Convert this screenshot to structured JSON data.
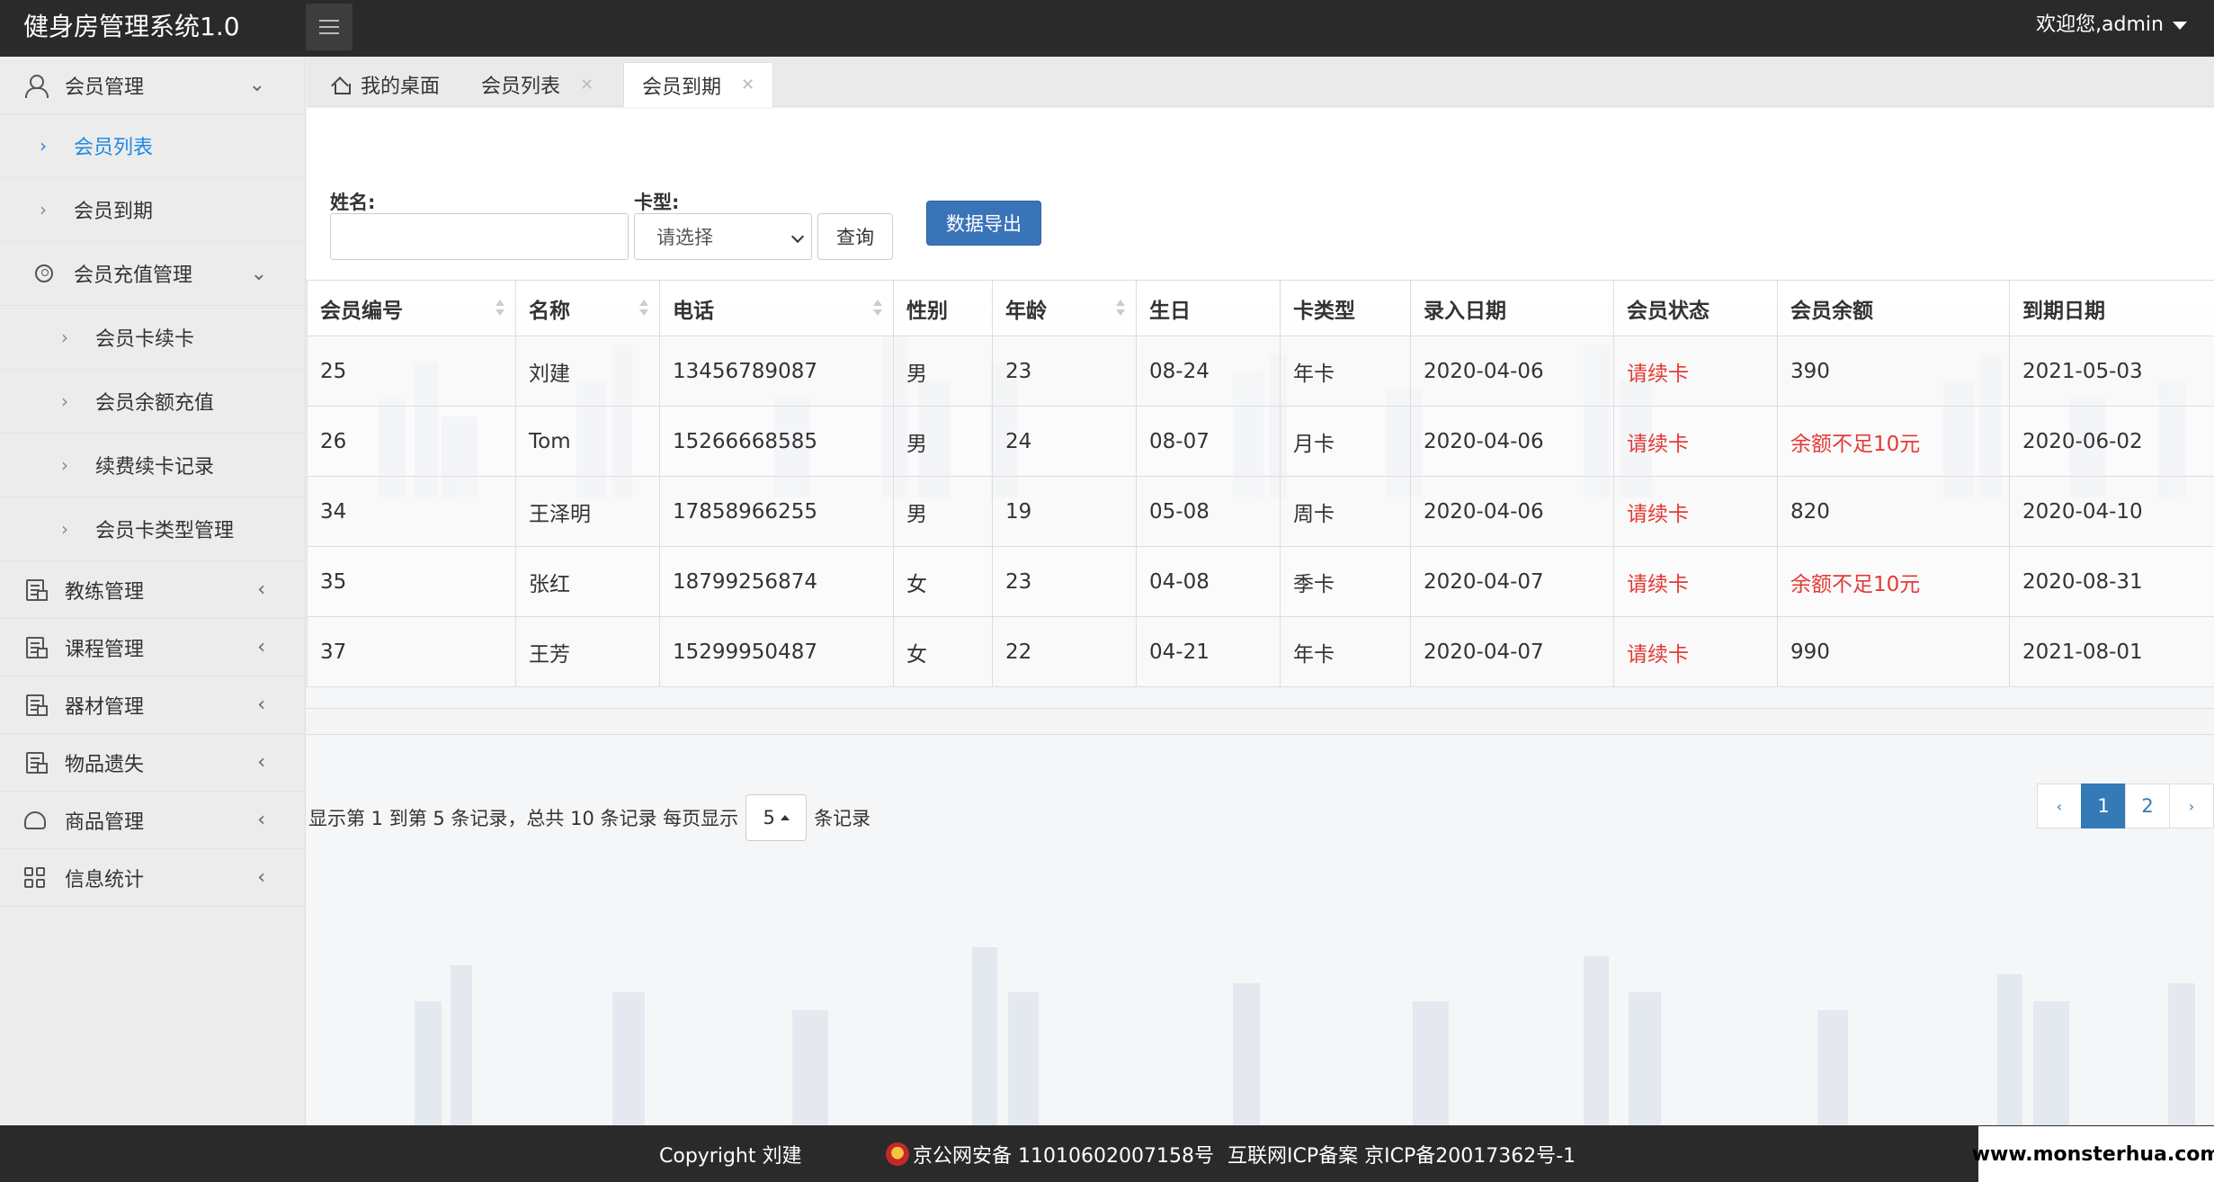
{
  "header": {
    "app_title": "健身房管理系统1.0",
    "welcome": "欢迎您,admin"
  },
  "sidebar": {
    "member_mgmt": "会员管理",
    "member_list": "会员列表",
    "member_expire": "会员到期",
    "recharge_mgmt": "会员充值管理",
    "card_renew": "会员卡续卡",
    "balance_recharge": "会员余额充值",
    "renew_records": "续费续卡记录",
    "card_type_mgmt": "会员卡类型管理",
    "coach_mgmt": "教练管理",
    "course_mgmt": "课程管理",
    "equipment_mgmt": "器材管理",
    "lost_items": "物品遗失",
    "goods_mgmt": "商品管理",
    "stats": "信息统计"
  },
  "tabs": {
    "home": "我的桌面",
    "member_list": "会员列表",
    "member_expire": "会员到期",
    "close": "✕"
  },
  "filter": {
    "name_label": "姓名:",
    "name_value": "",
    "card_label": "卡型:",
    "card_selected": "请选择",
    "query": "查询",
    "export": "数据导出"
  },
  "table": {
    "headers": [
      "会员编号",
      "名称",
      "电话",
      "性别",
      "年龄",
      "生日",
      "卡类型",
      "录入日期",
      "会员状态",
      "会员余额",
      "到期日期"
    ],
    "rows": [
      [
        "25",
        "刘建",
        "13456789087",
        "男",
        "23",
        "08-24",
        "年卡",
        "2020-04-06",
        "请续卡",
        "390",
        "2021-05-03"
      ],
      [
        "26",
        "Tom",
        "15266668585",
        "男",
        "24",
        "08-07",
        "月卡",
        "2020-04-06",
        "请续卡",
        "余额不足10元",
        "2020-06-02"
      ],
      [
        "34",
        "王泽明",
        "17858966255",
        "男",
        "19",
        "05-08",
        "周卡",
        "2020-04-06",
        "请续卡",
        "820",
        "2020-04-10"
      ],
      [
        "35",
        "张红",
        "18799256874",
        "女",
        "23",
        "04-08",
        "季卡",
        "2020-04-07",
        "请续卡",
        "余额不足10元",
        "2020-08-31"
      ],
      [
        "37",
        "王芳",
        "15299950487",
        "女",
        "22",
        "04-21",
        "年卡",
        "2020-04-07",
        "请续卡",
        "990",
        "2021-08-01"
      ]
    ]
  },
  "pager": {
    "info_prefix": "显示第 1 到第 5 条记录，总共 10 条记录 每页显示",
    "page_size": "5",
    "info_suffix": "条记录",
    "prev": "‹",
    "pages": [
      "1",
      "2"
    ],
    "current_page": "1",
    "next": "›"
  },
  "footer": {
    "copyright": "Copyright 刘建",
    "police": "京公网安备 11010602007158号",
    "icp": "互联网ICP备案 京ICP备20017362号-1",
    "site": "www.monsterhua.com"
  },
  "colors": {
    "header_bg": "#2a2a2a",
    "accent": "#337ab7",
    "active_link": "#1e88e5",
    "warning_text": "#e53935"
  }
}
